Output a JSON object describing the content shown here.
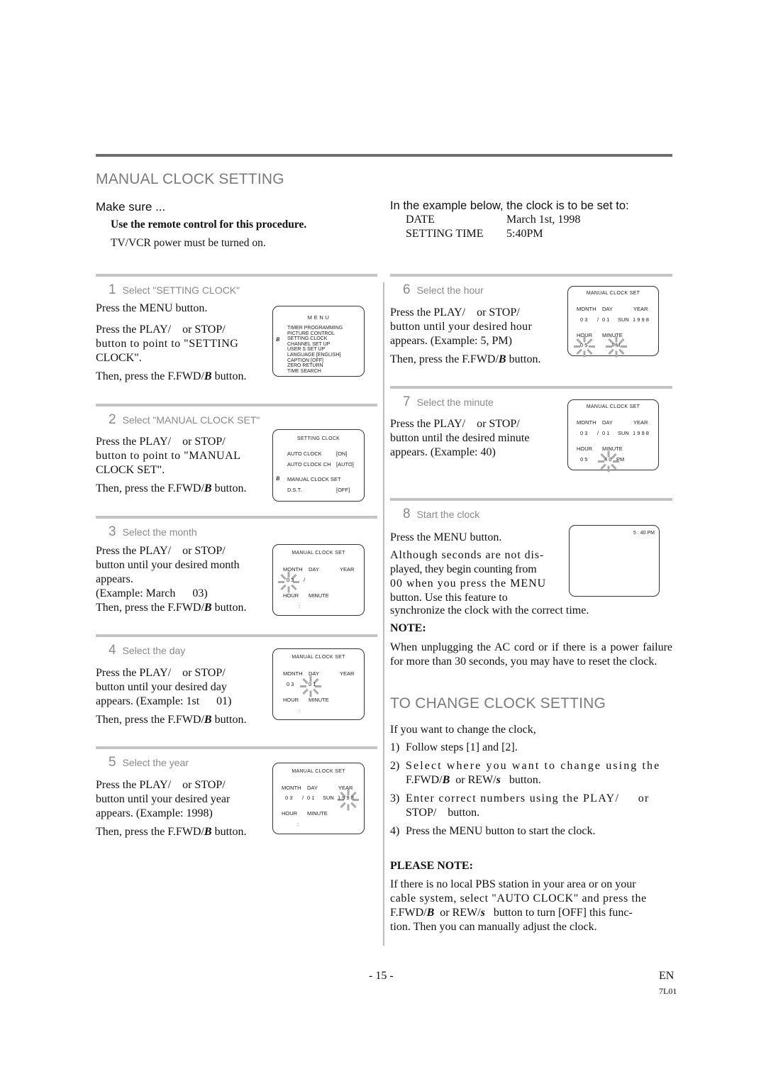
{
  "page": {
    "title": "MANUAL CLOCK SETTING",
    "make_sure": "Make sure ...",
    "remote_note": "Use the remote control for this procedure.",
    "power_note": "TV/VCR power must be turned on.",
    "example_intro": "In the example below, the clock is to be set to:",
    "example": {
      "date_label": "DATE",
      "date_value": "March 1st, 1998",
      "time_label": "SETTING TIME",
      "time_value": "5:40PM"
    }
  },
  "steps": [
    {
      "num": "1",
      "label": "Select \"SETTING CLOCK\"",
      "lines": [
        "Press the MENU button.",
        "Press the PLAY/    or STOP/",
        "button to point to \"SETTING",
        "CLOCK\".",
        "Then, press the F.FWD/",
        "B",
        " button."
      ]
    },
    {
      "num": "2",
      "label": "Select \"MANUAL CLOCK SET\"",
      "lines": [
        "Press the PLAY/    or STOP/",
        "button to point to \"MANUAL",
        "CLOCK SET\".",
        "Then, press the F.FWD/",
        "B",
        " button."
      ]
    },
    {
      "num": "3",
      "label": "Select the month",
      "lines": [
        "Press the PLAY/    or STOP/",
        "button until your desired month",
        "appears.",
        "(Example: March      03)",
        "Then, press the F.FWD/",
        "B",
        " button."
      ]
    },
    {
      "num": "4",
      "label": "Select the day",
      "lines": [
        "Press the PLAY/    or STOP/",
        "button until your desired day",
        "appears. (Example: 1st      01)",
        "Then, press the F.FWD/",
        "B",
        " button."
      ]
    },
    {
      "num": "5",
      "label": "Select the year",
      "lines": [
        "Press the PLAY/    or STOP/",
        "button until your desired year",
        "appears. (Example: 1998)",
        "Then, press the F.FWD/",
        "B",
        " button."
      ]
    },
    {
      "num": "6",
      "label": "Select the hour",
      "lines": [
        "Press the PLAY/    or STOP/",
        "button until your desired hour",
        "appears. (Example: 5, PM)",
        "Then, press the F.FWD/",
        "B",
        " button."
      ]
    },
    {
      "num": "7",
      "label": "Select the minute",
      "lines": [
        "Press the PLAY/    or STOP/",
        "button until the desired minute",
        "appears. (Example: 40)"
      ]
    },
    {
      "num": "8",
      "label": "Start the clock",
      "lines": [
        "Press the MENU button.",
        "Although seconds are not dis-",
        "played, they begin counting from",
        "00 when you press the MENU",
        "button. Use this feature to",
        "synchronize the clock with the correct time."
      ]
    }
  ],
  "screens": {
    "menu": {
      "title": "M E N U",
      "pointer": "B",
      "items": [
        "TIMER PROGRAMMING",
        "PICTURE CONTROL",
        "SETTING CLOCK",
        "CHANNEL SET UP",
        "USER S SET UP",
        "LANGUAGE  [ENGLISH]",
        "CAPTION  [OFF]",
        "ZERO RETURN",
        "TIME SEARCH"
      ]
    },
    "setting_clock": {
      "title": "SETTING CLOCK",
      "pointer": "B",
      "rows": [
        {
          "label": "AUTO CLOCK",
          "value": "[ON]"
        },
        {
          "label": "AUTO CLOCK CH",
          "value": "[AUTO]"
        },
        {
          "label": "MANUAL CLOCK SET",
          "value": ""
        },
        {
          "label": "D.S.T.",
          "value": "[OFF]"
        }
      ]
    },
    "manual_clock_set": {
      "title": "MANUAL CLOCK SET",
      "month_label": "MONTH",
      "day_label": "DAY",
      "year_label": "YEAR",
      "hour_label": "HOUR",
      "minute_label": "MINUTE",
      "month": "0 3",
      "slash": "/",
      "day": "0 1",
      "weekday": "SUN",
      "year": "1 9 9 8",
      "hour": "0 5",
      "colon": ":",
      "minute": "4 0",
      "ampm": "PM"
    },
    "final": {
      "time": "5 : 40 PM"
    }
  },
  "note": {
    "heading": "NOTE:",
    "text": "When unplugging the AC cord or if there is a power failure for more than 30 seconds, you may have to reset the clock."
  },
  "change": {
    "title": "TO CHANGE CLOCK SETTING",
    "intro": "If you want to change the clock,",
    "items": [
      {
        "n": "1)",
        "text": "Follow steps [1] and [2]."
      },
      {
        "n": "2)",
        "text_a": "Select where you want to change using the",
        "text_b": "F.FWD/",
        "b": "B",
        "text_c": "  or REW/",
        "s": "s",
        "text_d": "   button."
      },
      {
        "n": "3)",
        "text_a": "Enter correct numbers using the PLAY/     or",
        "text_b": "STOP/    button."
      },
      {
        "n": "4)",
        "text": "Press the MENU button to start the clock."
      }
    ]
  },
  "please_note": {
    "heading": "PLEASE NOTE:",
    "line1": "If there is no local PBS station in your area or on your",
    "line2": "cable system, select \"AUTO CLOCK\" and press the",
    "line3_a": "F.FWD/",
    "line3_b": "B",
    "line3_c": "  or REW/",
    "line3_d": "s",
    "line3_e": "   button to turn [OFF] this func-",
    "line4": "tion. Then you can manually adjust the clock."
  },
  "footer": {
    "page": "- 15 -",
    "lang": "EN",
    "code": "7L01"
  }
}
